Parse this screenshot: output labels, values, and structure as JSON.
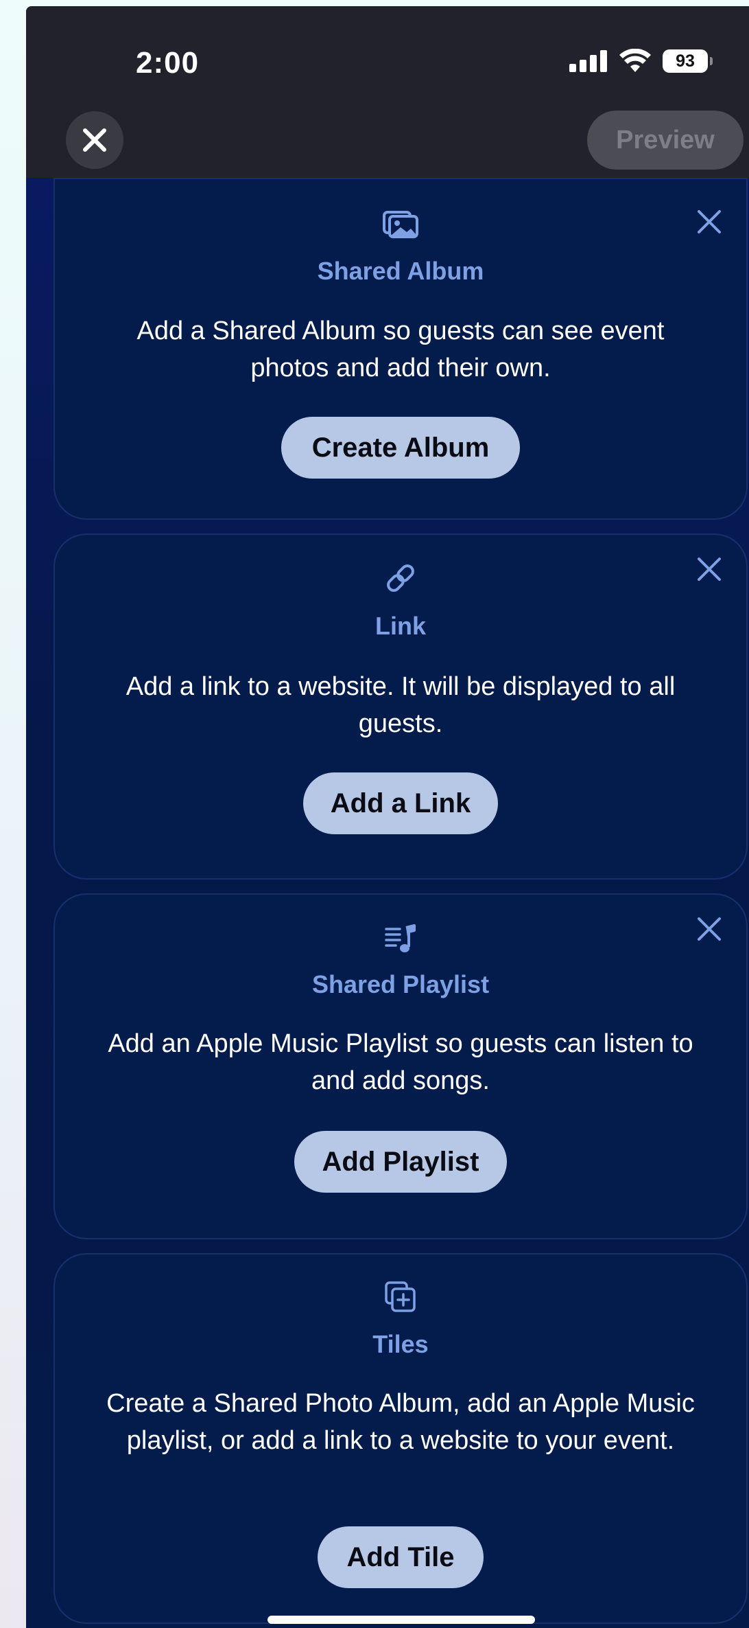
{
  "status_bar": {
    "time": "2:00",
    "battery": "93"
  },
  "nav": {
    "close_icon": "close-icon",
    "preview_label": "Preview"
  },
  "cards": [
    {
      "icon": "photo-stack-icon",
      "title": "Shared Album",
      "description": "Add a Shared Album so guests can see event photos and add their own.",
      "button": "Create Album",
      "dismissible": true
    },
    {
      "icon": "link-icon",
      "title": "Link",
      "description": "Add a link to a website. It will be displayed to all guests.",
      "button": "Add a Link",
      "dismissible": true
    },
    {
      "icon": "music-list-icon",
      "title": "Shared Playlist",
      "description": "Add an Apple Music Playlist so guests can listen to and add songs.",
      "button": "Add Playlist",
      "dismissible": true
    },
    {
      "icon": "plus-square-stack-icon",
      "title": "Tiles",
      "description": "Create a Shared Photo Album, add an Apple Music playlist, or add a link to a website to your event.",
      "button": "Add Tile",
      "dismissible": false
    }
  ],
  "colors": {
    "accent": "#7da1e4",
    "card_bg": "#041c4c",
    "button_bg": "#b6c8e6",
    "topbar_bg": "#22222c"
  }
}
